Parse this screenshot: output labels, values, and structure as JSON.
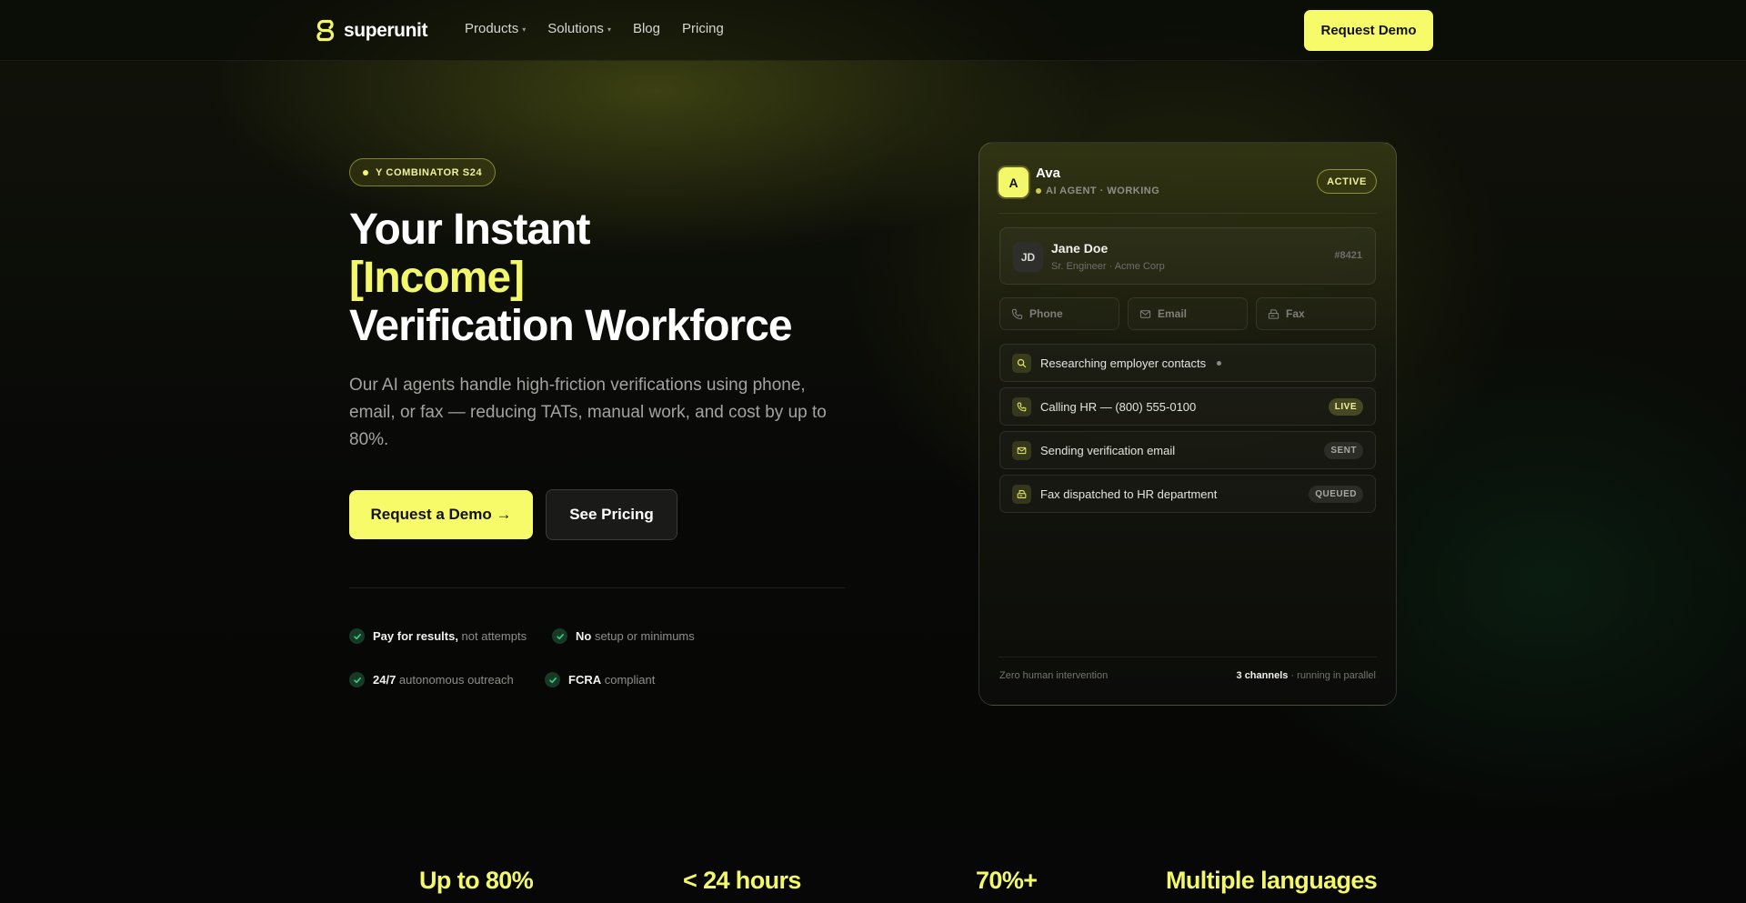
{
  "colors": {
    "accent": "#f7fb6a",
    "background": "#070806",
    "check_green": "#163a25"
  },
  "nav": {
    "logo_text": "superunit",
    "links": [
      {
        "label": "Products",
        "caret": "▾",
        "icon": "chevron-down-icon"
      },
      {
        "label": "Solutions",
        "caret": "▾",
        "icon": "chevron-down-icon"
      },
      {
        "label": "Blog"
      },
      {
        "label": "Pricing"
      }
    ],
    "cta_label": "Request Demo"
  },
  "hero": {
    "badge": "Y COMBINATOR S24",
    "headline_line1": "Your Instant",
    "headline_accent": "[Income]",
    "headline_line3": "Verification Workforce",
    "subhead": "Our AI agents handle high-friction verifications using phone, email, or fax — reducing TATs, manual work, and cost by up to 80%.",
    "primary_cta": "Request a Demo →",
    "secondary_cta": "See Pricing",
    "features": [
      {
        "bold": "Pay for results,",
        "rest": " not attempts"
      },
      {
        "bold": "No",
        "rest": " setup or minimums"
      },
      {
        "bold": "24/7",
        "rest": " autonomous outreach"
      },
      {
        "bold": "FCRA",
        "rest": " compliant"
      }
    ]
  },
  "agent_card": {
    "avatar_letter": "A",
    "name": "Ava",
    "role": "AI AGENT · WORKING",
    "status": "ACTIVE",
    "candidate": {
      "initials": "JD",
      "name": "Jane Doe",
      "subtitle": "Sr. Engineer · Acme Corp",
      "id": "#8421"
    },
    "channels": [
      {
        "label": "Phone",
        "icon": "phone-icon"
      },
      {
        "label": "Email",
        "icon": "mail-icon"
      },
      {
        "label": "Fax",
        "icon": "fax-icon"
      }
    ],
    "tasks": [
      {
        "label": "Researching employer contacts",
        "icon": "search-icon",
        "tag": ""
      },
      {
        "label": "Calling HR — (800) 555-0100",
        "icon": "phone-icon",
        "tag": "LIVE"
      },
      {
        "label": "Sending verification email",
        "icon": "mail-icon",
        "tag": "SENT"
      },
      {
        "label": "Fax dispatched to HR department",
        "icon": "fax-icon",
        "tag": "QUEUED"
      }
    ],
    "footer_left": "Zero human intervention",
    "footer_right_bold": "3 channels",
    "footer_right_rest": " · running in parallel"
  },
  "stats": [
    "Up to 80%",
    "< 24 hours",
    "70%+",
    "Multiple languages"
  ]
}
